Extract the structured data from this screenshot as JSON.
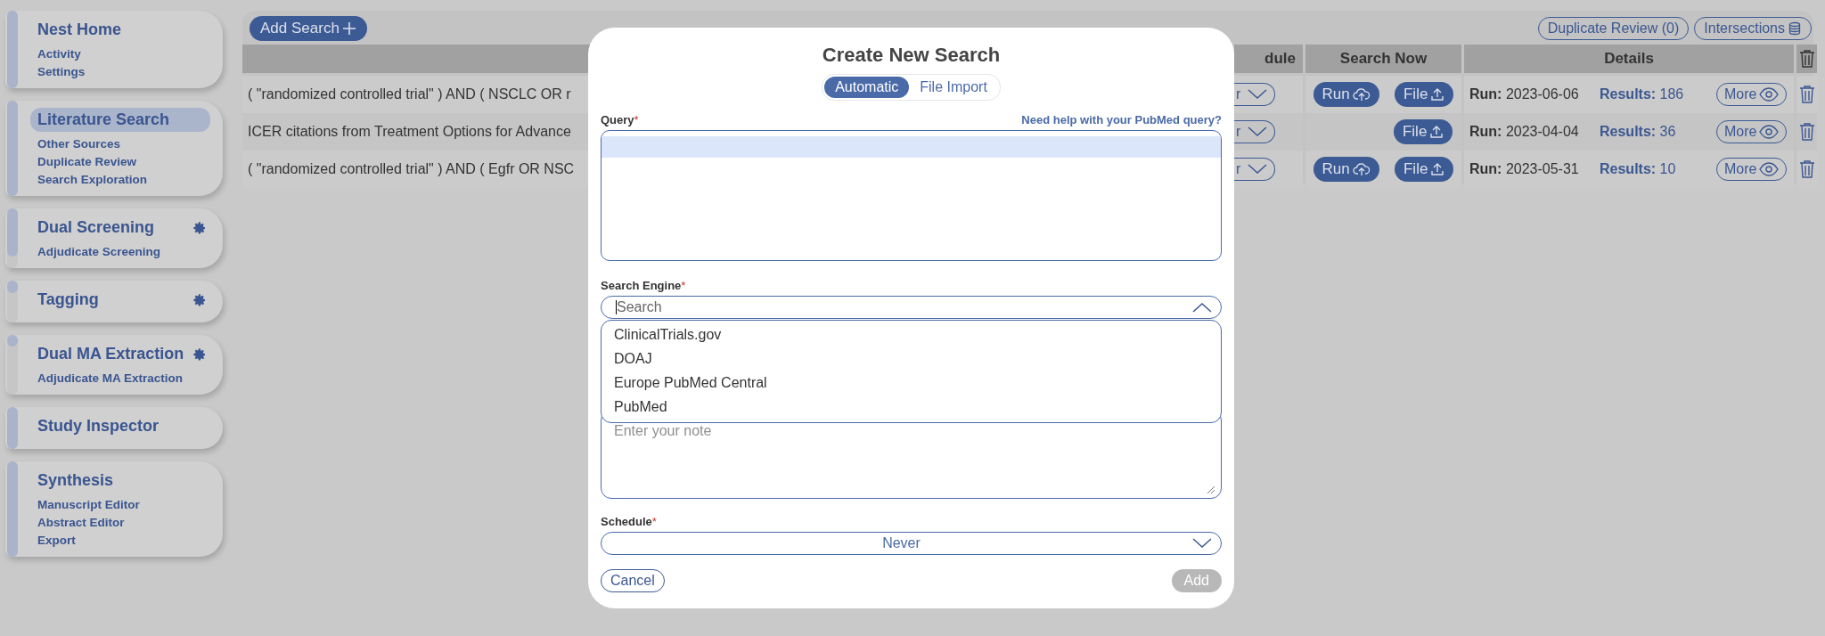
{
  "sidebar": [
    {
      "title": "Nest Home",
      "selected": false,
      "level": 1,
      "settings": false,
      "items": [
        {
          "label": "Activity"
        },
        {
          "label": "Settings"
        }
      ]
    },
    {
      "title": "Literature Search",
      "selected": true,
      "level": 1,
      "settings": false,
      "items": [
        {
          "label": "Other Sources"
        },
        {
          "label": "Duplicate Review"
        },
        {
          "label": "Search Exploration"
        }
      ]
    },
    {
      "title": "Dual Screening",
      "selected": false,
      "level": 0.8,
      "settings": true,
      "items": [
        {
          "label": "Adjudicate Screening"
        }
      ]
    },
    {
      "title": "Tagging",
      "selected": false,
      "level": 0.3,
      "settings": true
    },
    {
      "title": "Dual MA Extraction",
      "selected": false,
      "level": 0.2,
      "settings": true,
      "items": [
        {
          "label": "Adjudicate MA Extraction"
        }
      ]
    },
    {
      "title": "Study Inspector",
      "selected": false,
      "level": 1,
      "settings": false
    },
    {
      "title": "Synthesis",
      "selected": false,
      "level": 1,
      "settings": false,
      "items": [
        {
          "label": "Manuscript Editor"
        },
        {
          "label": "Abstract Editor"
        },
        {
          "label": "Export"
        }
      ]
    }
  ],
  "toolbar": {
    "add_button": "Add Search",
    "duplicate_button": "Duplicate Review (0)",
    "intersections_button": "Intersections"
  },
  "table": {
    "columns": [
      "dule",
      "Search Now",
      "Details"
    ],
    "rows": [
      {
        "query": "( \"randomized controlled trial\" ) AND ( NSCLC OR r",
        "schedule": "r",
        "run_button": "Run",
        "file_button": "File",
        "run": "**Run:** 2023-06-06",
        "results": "**Results:** 186",
        "more_button": "More"
      },
      {
        "query": "ICER citations from Treatment Options for Advance",
        "schedule": "r",
        "file_button": "File",
        "run": "**Run:** 2023-04-04",
        "results": "**Results:** 36",
        "more_button": "More"
      },
      {
        "query": "( \"randomized controlled trial\" ) AND ( Egfr OR NSC",
        "schedule": "r",
        "run_button": "Run",
        "file_button": "File",
        "run": "**Run:** 2023-05-31",
        "results": "**Results:** 10",
        "more_button": "More"
      }
    ]
  },
  "modal": {
    "title": "Create New Search",
    "tabs": [
      {
        "label": "Automatic",
        "selected": true
      },
      {
        "label": "File Import",
        "selected": false
      }
    ],
    "query": {
      "label": "Query",
      "required_mark": "*",
      "help_link": "Need help with your PubMed query?"
    },
    "engine": {
      "label": "Search Engine",
      "required_mark": "*",
      "placeholder": "Search",
      "expanded": true,
      "options": [
        "ClinicalTrials.gov",
        "DOAJ",
        "Europe PubMed Central",
        "PubMed"
      ]
    },
    "note": {
      "placeholder": "Enter your note"
    },
    "schedule": {
      "label": "Schedule",
      "required_mark": "*",
      "value": "Never"
    },
    "cancel_button": "Cancel",
    "add_button": {
      "label": "Add",
      "disabled": true
    }
  }
}
